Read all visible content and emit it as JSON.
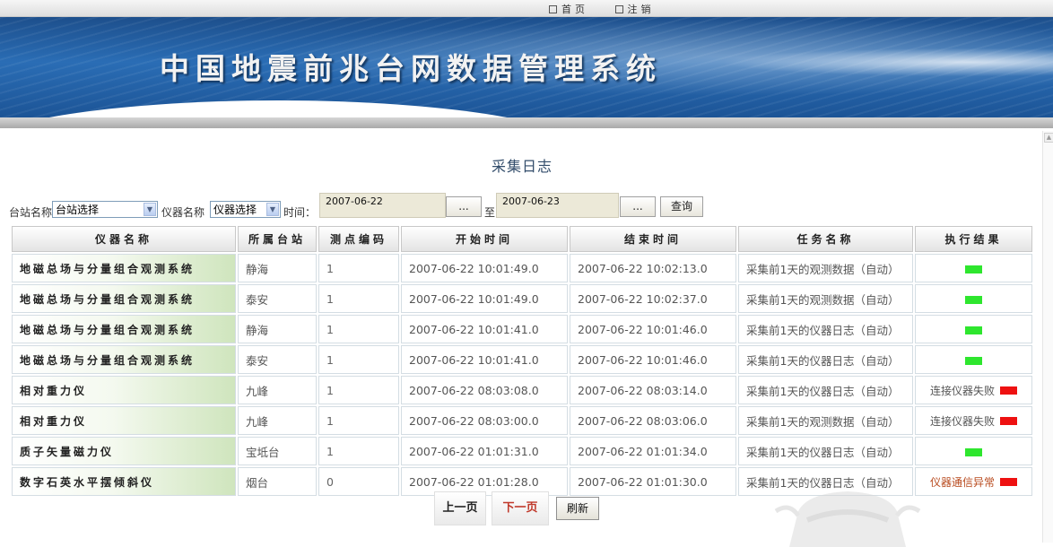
{
  "header": {
    "system_title": "中国地震前兆台网数据管理系统",
    "nav": {
      "home": "首页",
      "logout": "注销"
    }
  },
  "page": {
    "title": "采集日志"
  },
  "filters": {
    "station_label": "台站名称",
    "station_value": "台站选择",
    "instrument_label": "仪器名称",
    "instrument_value": "仪器选择",
    "time_label": "时间：",
    "start_date": "2007-06-22",
    "to_label": "至",
    "end_date": "2007-06-23",
    "picker_label": "...",
    "query_label": "查询"
  },
  "table": {
    "columns": [
      "仪器名称",
      "所属台站",
      "测点编码",
      "开始时间",
      "结束时间",
      "任务名称",
      "执行结果"
    ],
    "rows": [
      {
        "instrument": "地磁总场与分量组合观测系统",
        "station": "静海",
        "point": "1",
        "start": "2007-06-22 10:01:49.0",
        "end": "2007-06-22 10:02:13.0",
        "task": "采集前1天的观测数据（自动）",
        "status": "ok",
        "result": ""
      },
      {
        "instrument": "地磁总场与分量组合观测系统",
        "station": "泰安",
        "point": "1",
        "start": "2007-06-22 10:01:49.0",
        "end": "2007-06-22 10:02:37.0",
        "task": "采集前1天的观测数据（自动）",
        "status": "ok",
        "result": ""
      },
      {
        "instrument": "地磁总场与分量组合观测系统",
        "station": "静海",
        "point": "1",
        "start": "2007-06-22 10:01:41.0",
        "end": "2007-06-22 10:01:46.0",
        "task": "采集前1天的仪器日志（自动）",
        "status": "ok",
        "result": ""
      },
      {
        "instrument": "地磁总场与分量组合观测系统",
        "station": "泰安",
        "point": "1",
        "start": "2007-06-22 10:01:41.0",
        "end": "2007-06-22 10:01:46.0",
        "task": "采集前1天的仪器日志（自动）",
        "status": "ok",
        "result": ""
      },
      {
        "instrument": "相对重力仪",
        "station": "九峰",
        "point": "1",
        "start": "2007-06-22 08:03:08.0",
        "end": "2007-06-22 08:03:14.0",
        "task": "采集前1天的仪器日志（自动）",
        "status": "error",
        "result": "连接仪器失败"
      },
      {
        "instrument": "相对重力仪",
        "station": "九峰",
        "point": "1",
        "start": "2007-06-22 08:03:00.0",
        "end": "2007-06-22 08:03:06.0",
        "task": "采集前1天的观测数据（自动）",
        "status": "error",
        "result": "连接仪器失败"
      },
      {
        "instrument": "质子矢量磁力仪",
        "station": "宝坻台",
        "point": "1",
        "start": "2007-06-22 01:01:31.0",
        "end": "2007-06-22 01:01:34.0",
        "task": "采集前1天的仪器日志（自动）",
        "status": "ok",
        "result": ""
      },
      {
        "instrument": "数字石英水平摆倾斜仪",
        "station": "烟台",
        "point": "0",
        "start": "2007-06-22 01:01:28.0",
        "end": "2007-06-22 01:01:30.0",
        "task": "采集前1天的仪器日志（自动）",
        "status": "warn",
        "result": "仪器通信异常"
      }
    ]
  },
  "pager": {
    "prev": "上一页",
    "next": "下一页",
    "refresh": "刷新"
  },
  "colors": {
    "status_ok": "#2ee62e",
    "status_error": "#ee1111",
    "header_blue": "#2a6db5",
    "next_link": "#c0392b"
  },
  "icons": {
    "nav_bullet": "square-bullet-icon",
    "dropdown": "dropdown-arrow-icon",
    "status_ok": "green-status-indicator",
    "status_error": "red-status-indicator"
  }
}
